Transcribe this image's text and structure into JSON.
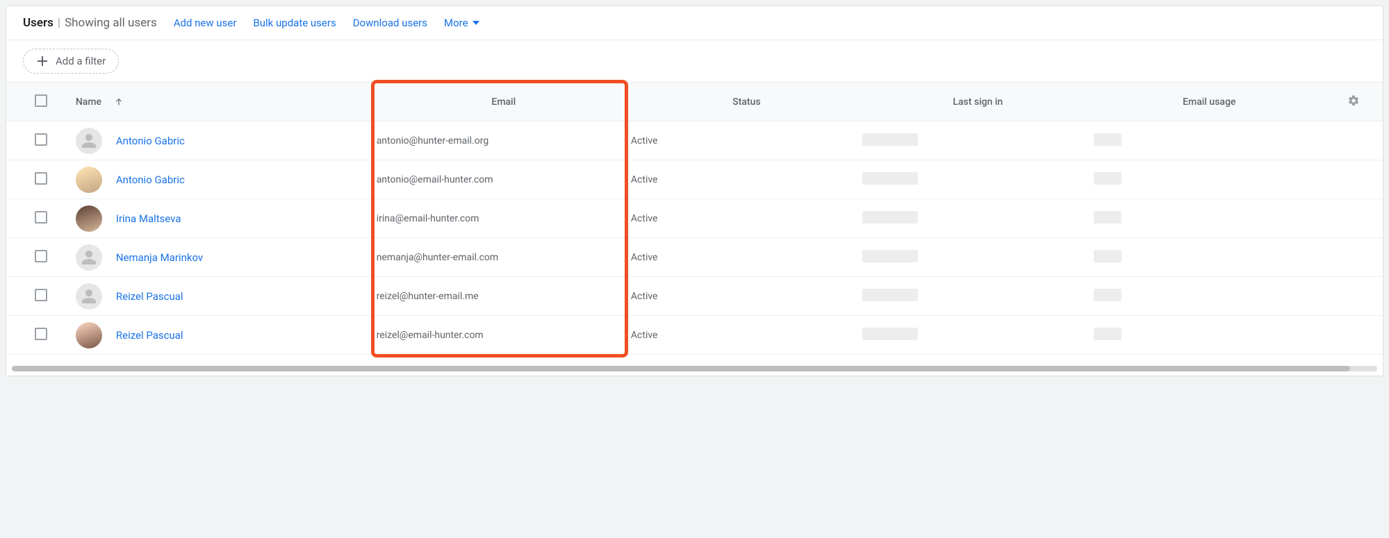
{
  "toolbar": {
    "title_strong": "Users",
    "title_light": "Showing all users",
    "add_user": "Add new user",
    "bulk_update": "Bulk update users",
    "download": "Download users",
    "more": "More"
  },
  "filter": {
    "add_filter_label": "Add a filter"
  },
  "columns": {
    "name": "Name",
    "email": "Email",
    "status": "Status",
    "signin": "Last sign in",
    "usage": "Email usage"
  },
  "rows": [
    {
      "name": "Antonio Gabric",
      "email": "antonio@hunter-email.org",
      "status": "Active",
      "avatar": "default"
    },
    {
      "name": "Antonio Gabric",
      "email": "antonio@email-hunter.com",
      "status": "Active",
      "avatar": "photo1"
    },
    {
      "name": "Irina Maltseva",
      "email": "irina@email-hunter.com",
      "status": "Active",
      "avatar": "photo2"
    },
    {
      "name": "Nemanja Marinkov",
      "email": "nemanja@hunter-email.com",
      "status": "Active",
      "avatar": "default"
    },
    {
      "name": "Reizel Pascual",
      "email": "reizel@hunter-email.me",
      "status": "Active",
      "avatar": "default"
    },
    {
      "name": "Reizel Pascual",
      "email": "reizel@email-hunter.com",
      "status": "Active",
      "avatar": "photo3"
    }
  ]
}
